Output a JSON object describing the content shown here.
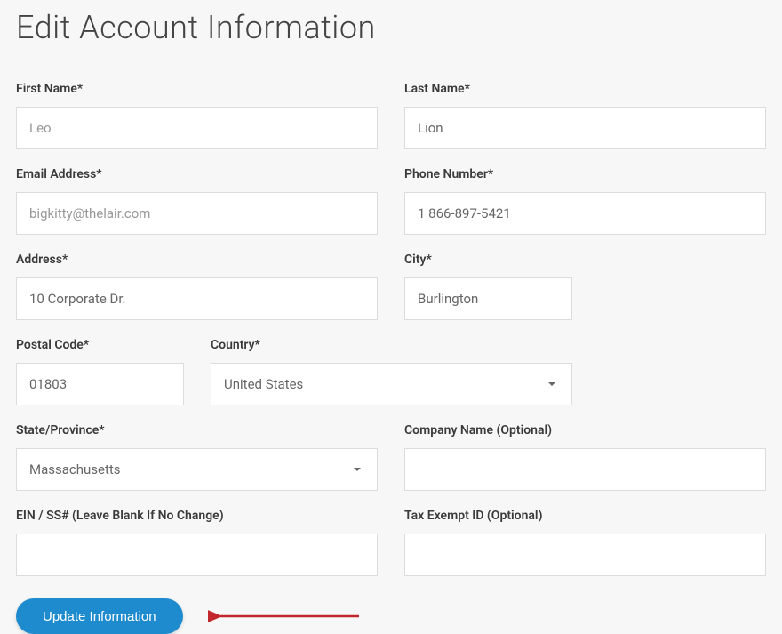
{
  "page": {
    "title": "Edit Account Information"
  },
  "form": {
    "first_name": {
      "label": "First Name*",
      "value": "Leo"
    },
    "last_name": {
      "label": "Last Name*",
      "value": "Lion"
    },
    "email": {
      "label": "Email Address*",
      "value": "bigkitty@thelair.com"
    },
    "phone": {
      "label": "Phone Number*",
      "value": "1 866-897-5421"
    },
    "address": {
      "label": "Address*",
      "value": "10 Corporate Dr."
    },
    "city": {
      "label": "City*",
      "value": "Burlington"
    },
    "postal_code": {
      "label": "Postal Code*",
      "value": "01803"
    },
    "country": {
      "label": "Country*",
      "value": "United States"
    },
    "state": {
      "label": "State/Province*",
      "value": "Massachusetts"
    },
    "company_name": {
      "label": "Company Name (Optional)",
      "value": ""
    },
    "ein_ss": {
      "label": "EIN / SS# (Leave Blank If No Change)",
      "value": ""
    },
    "tax_exempt": {
      "label": "Tax Exempt ID (Optional)",
      "value": ""
    }
  },
  "actions": {
    "submit_label": "Update Information"
  }
}
